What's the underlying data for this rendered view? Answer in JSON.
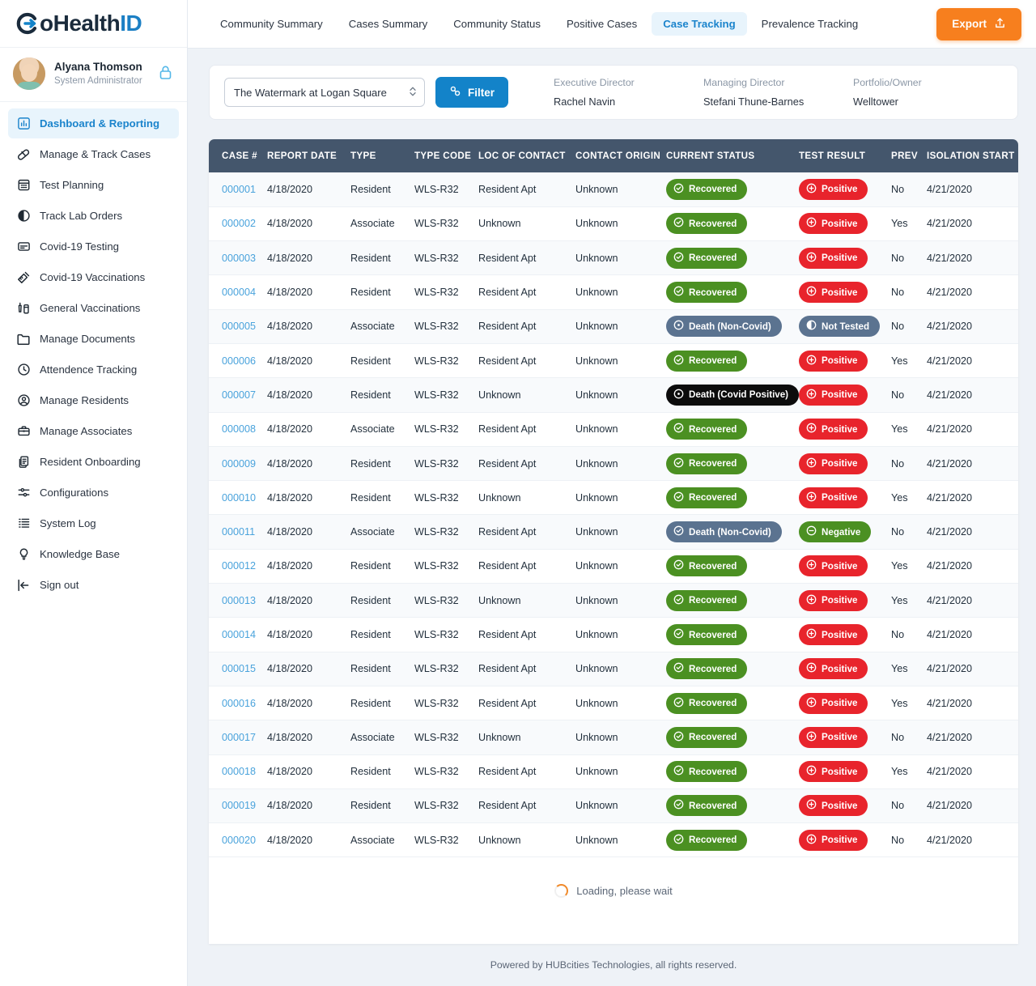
{
  "brand": {
    "name_dark_a": "G",
    "name_dark_b": "o",
    "name_dark_c": "Health",
    "name_blue": "ID"
  },
  "profile": {
    "name": "Alyana Thomson",
    "role": "System Administrator"
  },
  "sidebar": {
    "items": [
      {
        "label": "Dashboard & Reporting",
        "icon": "chart-bar-icon",
        "active": true
      },
      {
        "label": "Manage & Track Cases",
        "icon": "pill-icon",
        "active": false
      },
      {
        "label": "Test Planning",
        "icon": "calendar-icon",
        "active": false
      },
      {
        "label": "Track Lab Orders",
        "icon": "half-circle-icon",
        "active": false
      },
      {
        "label": "Covid-19 Testing",
        "icon": "test-card-icon",
        "active": false
      },
      {
        "label": "Covid-19 Vaccinations",
        "icon": "syringe-icon",
        "active": false
      },
      {
        "label": "General Vaccinations",
        "icon": "vaccine-vial-icon",
        "active": false
      },
      {
        "label": "Manage Documents",
        "icon": "folder-icon",
        "active": false
      },
      {
        "label": "Attendence Tracking",
        "icon": "clock-icon",
        "active": false
      },
      {
        "label": "Manage Residents",
        "icon": "user-circle-icon",
        "active": false
      },
      {
        "label": "Manage Associates",
        "icon": "briefcase-icon",
        "active": false
      },
      {
        "label": "Resident Onboarding",
        "icon": "documents-icon",
        "active": false
      },
      {
        "label": "Configurations",
        "icon": "sliders-icon",
        "active": false
      },
      {
        "label": "System Log",
        "icon": "list-icon",
        "active": false
      },
      {
        "label": "Knowledge Base",
        "icon": "lightbulb-icon",
        "active": false
      },
      {
        "label": "Sign out",
        "icon": "sign-out-icon",
        "active": false
      }
    ]
  },
  "topbar": {
    "tabs": [
      {
        "label": "Community Summary",
        "active": false
      },
      {
        "label": "Cases Summary",
        "active": false
      },
      {
        "label": "Community Status",
        "active": false
      },
      {
        "label": "Positive Cases",
        "active": false
      },
      {
        "label": "Case Tracking",
        "active": true
      },
      {
        "label": "Prevalence Tracking",
        "active": false
      }
    ],
    "export_label": "Export"
  },
  "filter_bar": {
    "community_selected": "The Watermark at Logan Square",
    "filter_label": "Filter",
    "meta": [
      {
        "label": "Executive Director",
        "value": "Rachel Navin"
      },
      {
        "label": "Managing Director",
        "value": "Stefani Thune-Barnes"
      },
      {
        "label": "Portfolio/Owner",
        "value": "Welltower"
      }
    ]
  },
  "table": {
    "columns": [
      "CASE #",
      "REPORT DATE",
      "TYPE",
      "TYPE CODE",
      "LOC OF CONTACT",
      "CONTACT ORIGIN",
      "CURRENT STATUS",
      "TEST RESULT",
      "PREV",
      "ISOLATION START"
    ],
    "rows": [
      {
        "case": "000001",
        "report_date": "4/18/2020",
        "type": "Resident",
        "type_code": "WLS-R32",
        "loc": "Resident Apt",
        "origin": "Unknown",
        "status": "Recovered",
        "status_style": "green",
        "status_icon": "check-circle-icon",
        "result": "Positive",
        "result_style": "red",
        "result_icon": "plus-circle-icon",
        "prev": "No",
        "iso": "4/21/2020"
      },
      {
        "case": "000002",
        "report_date": "4/18/2020",
        "type": "Associate",
        "type_code": "WLS-R32",
        "loc": "Unknown",
        "origin": "Unknown",
        "status": "Recovered",
        "status_style": "green",
        "status_icon": "check-circle-icon",
        "result": "Positive",
        "result_style": "red",
        "result_icon": "plus-circle-icon",
        "prev": "Yes",
        "iso": "4/21/2020"
      },
      {
        "case": "000003",
        "report_date": "4/18/2020",
        "type": "Resident",
        "type_code": "WLS-R32",
        "loc": "Resident Apt",
        "origin": "Unknown",
        "status": "Recovered",
        "status_style": "green",
        "status_icon": "check-circle-icon",
        "result": "Positive",
        "result_style": "red",
        "result_icon": "plus-circle-icon",
        "prev": "No",
        "iso": "4/21/2020"
      },
      {
        "case": "000004",
        "report_date": "4/18/2020",
        "type": "Resident",
        "type_code": "WLS-R32",
        "loc": "Resident Apt",
        "origin": "Unknown",
        "status": "Recovered",
        "status_style": "green",
        "status_icon": "check-circle-icon",
        "result": "Positive",
        "result_style": "red",
        "result_icon": "plus-circle-icon",
        "prev": "No",
        "iso": "4/21/2020"
      },
      {
        "case": "000005",
        "report_date": "4/18/2020",
        "type": "Associate",
        "type_code": "WLS-R32",
        "loc": "Resident Apt",
        "origin": "Unknown",
        "status": "Death (Non-Covid)",
        "status_style": "slate",
        "status_icon": "dot-circle-icon",
        "result": "Not Tested",
        "result_style": "slate",
        "result_icon": "half-circle-icon",
        "prev": "No",
        "iso": "4/21/2020"
      },
      {
        "case": "000006",
        "report_date": "4/18/2020",
        "type": "Resident",
        "type_code": "WLS-R32",
        "loc": "Resident Apt",
        "origin": "Unknown",
        "status": "Recovered",
        "status_style": "green",
        "status_icon": "check-circle-icon",
        "result": "Positive",
        "result_style": "red",
        "result_icon": "plus-circle-icon",
        "prev": "Yes",
        "iso": "4/21/2020"
      },
      {
        "case": "000007",
        "report_date": "4/18/2020",
        "type": "Resident",
        "type_code": "WLS-R32",
        "loc": "Unknown",
        "origin": "Unknown",
        "status": "Death (Covid Positive)",
        "status_style": "black",
        "status_icon": "dot-circle-icon",
        "result": "Positive",
        "result_style": "red",
        "result_icon": "plus-circle-icon",
        "prev": "No",
        "iso": "4/21/2020"
      },
      {
        "case": "000008",
        "report_date": "4/18/2020",
        "type": "Associate",
        "type_code": "WLS-R32",
        "loc": "Resident Apt",
        "origin": "Unknown",
        "status": "Recovered",
        "status_style": "green",
        "status_icon": "check-circle-icon",
        "result": "Positive",
        "result_style": "red",
        "result_icon": "plus-circle-icon",
        "prev": "Yes",
        "iso": "4/21/2020"
      },
      {
        "case": "000009",
        "report_date": "4/18/2020",
        "type": "Resident",
        "type_code": "WLS-R32",
        "loc": "Resident Apt",
        "origin": "Unknown",
        "status": "Recovered",
        "status_style": "green",
        "status_icon": "check-circle-icon",
        "result": "Positive",
        "result_style": "red",
        "result_icon": "plus-circle-icon",
        "prev": "No",
        "iso": "4/21/2020"
      },
      {
        "case": "000010",
        "report_date": "4/18/2020",
        "type": "Resident",
        "type_code": "WLS-R32",
        "loc": "Unknown",
        "origin": "Unknown",
        "status": "Recovered",
        "status_style": "green",
        "status_icon": "check-circle-icon",
        "result": "Positive",
        "result_style": "red",
        "result_icon": "plus-circle-icon",
        "prev": "Yes",
        "iso": "4/21/2020"
      },
      {
        "case": "000011",
        "report_date": "4/18/2020",
        "type": "Associate",
        "type_code": "WLS-R32",
        "loc": "Resident Apt",
        "origin": "Unknown",
        "status": "Death (Non-Covid)",
        "status_style": "slate",
        "status_icon": "check-circle-icon",
        "result": "Negative",
        "result_style": "green",
        "result_icon": "minus-circle-icon",
        "prev": "No",
        "iso": "4/21/2020"
      },
      {
        "case": "000012",
        "report_date": "4/18/2020",
        "type": "Resident",
        "type_code": "WLS-R32",
        "loc": "Resident Apt",
        "origin": "Unknown",
        "status": "Recovered",
        "status_style": "green",
        "status_icon": "check-circle-icon",
        "result": "Positive",
        "result_style": "red",
        "result_icon": "plus-circle-icon",
        "prev": "Yes",
        "iso": "4/21/2020"
      },
      {
        "case": "000013",
        "report_date": "4/18/2020",
        "type": "Resident",
        "type_code": "WLS-R32",
        "loc": "Unknown",
        "origin": "Unknown",
        "status": "Recovered",
        "status_style": "green",
        "status_icon": "check-circle-icon",
        "result": "Positive",
        "result_style": "red",
        "result_icon": "plus-circle-icon",
        "prev": "Yes",
        "iso": "4/21/2020"
      },
      {
        "case": "000014",
        "report_date": "4/18/2020",
        "type": "Resident",
        "type_code": "WLS-R32",
        "loc": "Resident Apt",
        "origin": "Unknown",
        "status": "Recovered",
        "status_style": "green",
        "status_icon": "check-circle-icon",
        "result": "Positive",
        "result_style": "red",
        "result_icon": "plus-circle-icon",
        "prev": "No",
        "iso": "4/21/2020"
      },
      {
        "case": "000015",
        "report_date": "4/18/2020",
        "type": "Resident",
        "type_code": "WLS-R32",
        "loc": "Resident Apt",
        "origin": "Unknown",
        "status": "Recovered",
        "status_style": "green",
        "status_icon": "check-circle-icon",
        "result": "Positive",
        "result_style": "red",
        "result_icon": "plus-circle-icon",
        "prev": "Yes",
        "iso": "4/21/2020"
      },
      {
        "case": "000016",
        "report_date": "4/18/2020",
        "type": "Resident",
        "type_code": "WLS-R32",
        "loc": "Resident Apt",
        "origin": "Unknown",
        "status": "Recovered",
        "status_style": "green",
        "status_icon": "check-circle-icon",
        "result": "Positive",
        "result_style": "red",
        "result_icon": "plus-circle-icon",
        "prev": "Yes",
        "iso": "4/21/2020"
      },
      {
        "case": "000017",
        "report_date": "4/18/2020",
        "type": "Associate",
        "type_code": "WLS-R32",
        "loc": "Unknown",
        "origin": "Unknown",
        "status": "Recovered",
        "status_style": "green",
        "status_icon": "check-circle-icon",
        "result": "Positive",
        "result_style": "red",
        "result_icon": "plus-circle-icon",
        "prev": "No",
        "iso": "4/21/2020"
      },
      {
        "case": "000018",
        "report_date": "4/18/2020",
        "type": "Resident",
        "type_code": "WLS-R32",
        "loc": "Resident Apt",
        "origin": "Unknown",
        "status": "Recovered",
        "status_style": "green",
        "status_icon": "check-circle-icon",
        "result": "Positive",
        "result_style": "red",
        "result_icon": "plus-circle-icon",
        "prev": "Yes",
        "iso": "4/21/2020"
      },
      {
        "case": "000019",
        "report_date": "4/18/2020",
        "type": "Resident",
        "type_code": "WLS-R32",
        "loc": "Resident Apt",
        "origin": "Unknown",
        "status": "Recovered",
        "status_style": "green",
        "status_icon": "check-circle-icon",
        "result": "Positive",
        "result_style": "red",
        "result_icon": "plus-circle-icon",
        "prev": "No",
        "iso": "4/21/2020"
      },
      {
        "case": "000020",
        "report_date": "4/18/2020",
        "type": "Associate",
        "type_code": "WLS-R32",
        "loc": "Unknown",
        "origin": "Unknown",
        "status": "Recovered",
        "status_style": "green",
        "status_icon": "check-circle-icon",
        "result": "Positive",
        "result_style": "red",
        "result_icon": "plus-circle-icon",
        "prev": "No",
        "iso": "4/21/2020"
      }
    ]
  },
  "loading": {
    "text": "Loading, please wait"
  },
  "footer": {
    "text": "Powered by HUBcities Technologies, all rights reserved."
  },
  "colors": {
    "accent_blue": "#1383c9",
    "export_orange": "#f77f1e",
    "header_slate": "#44566c",
    "badge_green": "#4b9022",
    "badge_red": "#e8242c",
    "badge_slate": "#5b7390",
    "badge_black": "#0c0c0c",
    "link_blue": "#4aa3dc"
  }
}
